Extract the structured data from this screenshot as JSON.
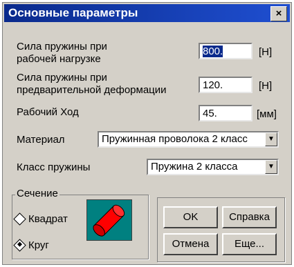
{
  "window": {
    "title": "Основные параметры",
    "close_label": "×"
  },
  "fields": {
    "spring_force": {
      "label_line1": "Сила пружины при",
      "label_line2": "рабочей нагрузке",
      "value": "800.",
      "unit": "[Н]"
    },
    "preload_force": {
      "label_line1": "Сила пружины при",
      "label_line2": "предварительной деформации",
      "value": "120.",
      "unit": "[Н]"
    },
    "stroke": {
      "label": "Рабочий Ход",
      "value": "45.",
      "unit": "[мм]"
    }
  },
  "material": {
    "label": "Материал",
    "value": "Пружинная проволока 2 класс"
  },
  "spring_class": {
    "label": "Класс пружины",
    "value": "Пружина 2 класса"
  },
  "section": {
    "legend": "Сечение",
    "options": {
      "square": "Квадрат",
      "circle": "Круг"
    },
    "selected": "circle"
  },
  "buttons": {
    "ok": "OK",
    "help": "Справка",
    "cancel": "Отмена",
    "more": "Еще..."
  },
  "colors": {
    "title_bar": "#0a2a8c",
    "section_preview_bg": "#008080",
    "rod": "#ff0000"
  }
}
